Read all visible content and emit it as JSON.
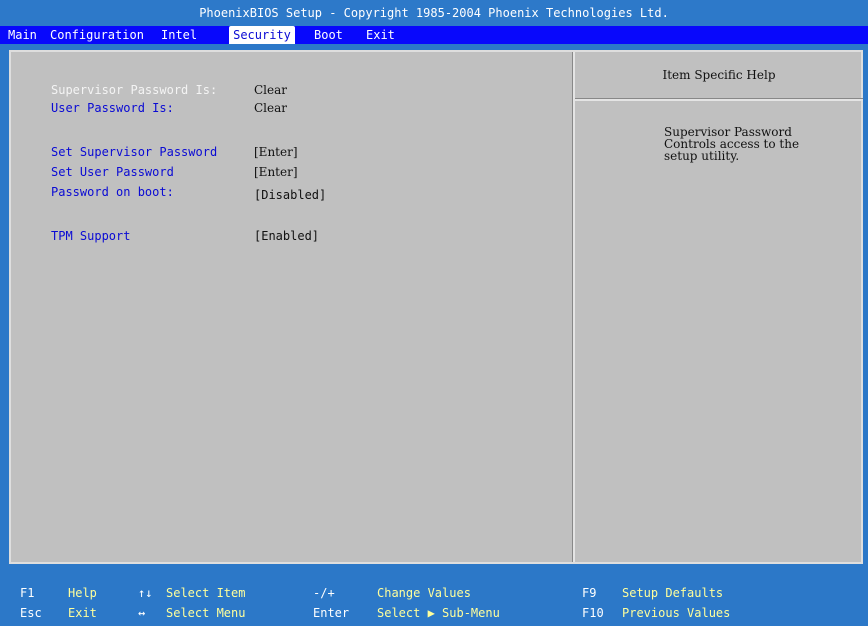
{
  "title": "PhoenixBIOS Setup - Copyright 1985-2004 Phoenix Technologies Ltd.",
  "menu": {
    "main": "Main",
    "configuration": "Configuration",
    "intel": "Intel",
    "security": "Security",
    "boot": "Boot",
    "exit": "Exit"
  },
  "settings": {
    "supervisor_password_is": {
      "label": "Supervisor Password Is:",
      "value": "Clear"
    },
    "user_password_is": {
      "label": "User Password Is:",
      "value": "Clear"
    },
    "set_supervisor_password": {
      "label": "Set Supervisor Password",
      "value": "[Enter]"
    },
    "set_user_password": {
      "label": "Set User Password",
      "value": "[Enter]"
    },
    "password_on_boot": {
      "label": "Password on boot:",
      "value": "[Disabled]"
    },
    "tpm_support": {
      "label": "TPM Support",
      "value": "[Enabled]"
    }
  },
  "help": {
    "title": "Item Specific Help",
    "lines": [
      "Supervisor Password",
      "Controls access to the",
      "setup utility."
    ]
  },
  "footer": {
    "f1_key": "F1",
    "f1_desc": "Help",
    "updown_key": "↑↓",
    "updown_desc": "Select Item",
    "plusminus_key": "-/+",
    "plusminus_desc": "Change Values",
    "f9_key": "F9",
    "f9_desc": "Setup Defaults",
    "esc_key": "Esc",
    "esc_desc": "Exit",
    "leftright_key": "↔",
    "leftright_desc": "Select Menu",
    "enter_key": "Enter",
    "enter_desc": "Select ▶ Sub-Menu",
    "f10_key": "F10",
    "f10_desc": "Previous Values"
  },
  "colors": {
    "background": "#2c78c8",
    "menu_bar": "#0808fc",
    "panel": "#c0c0c0",
    "label_blue": "#0a0ad4",
    "footer_desc": "#ffff9c"
  }
}
